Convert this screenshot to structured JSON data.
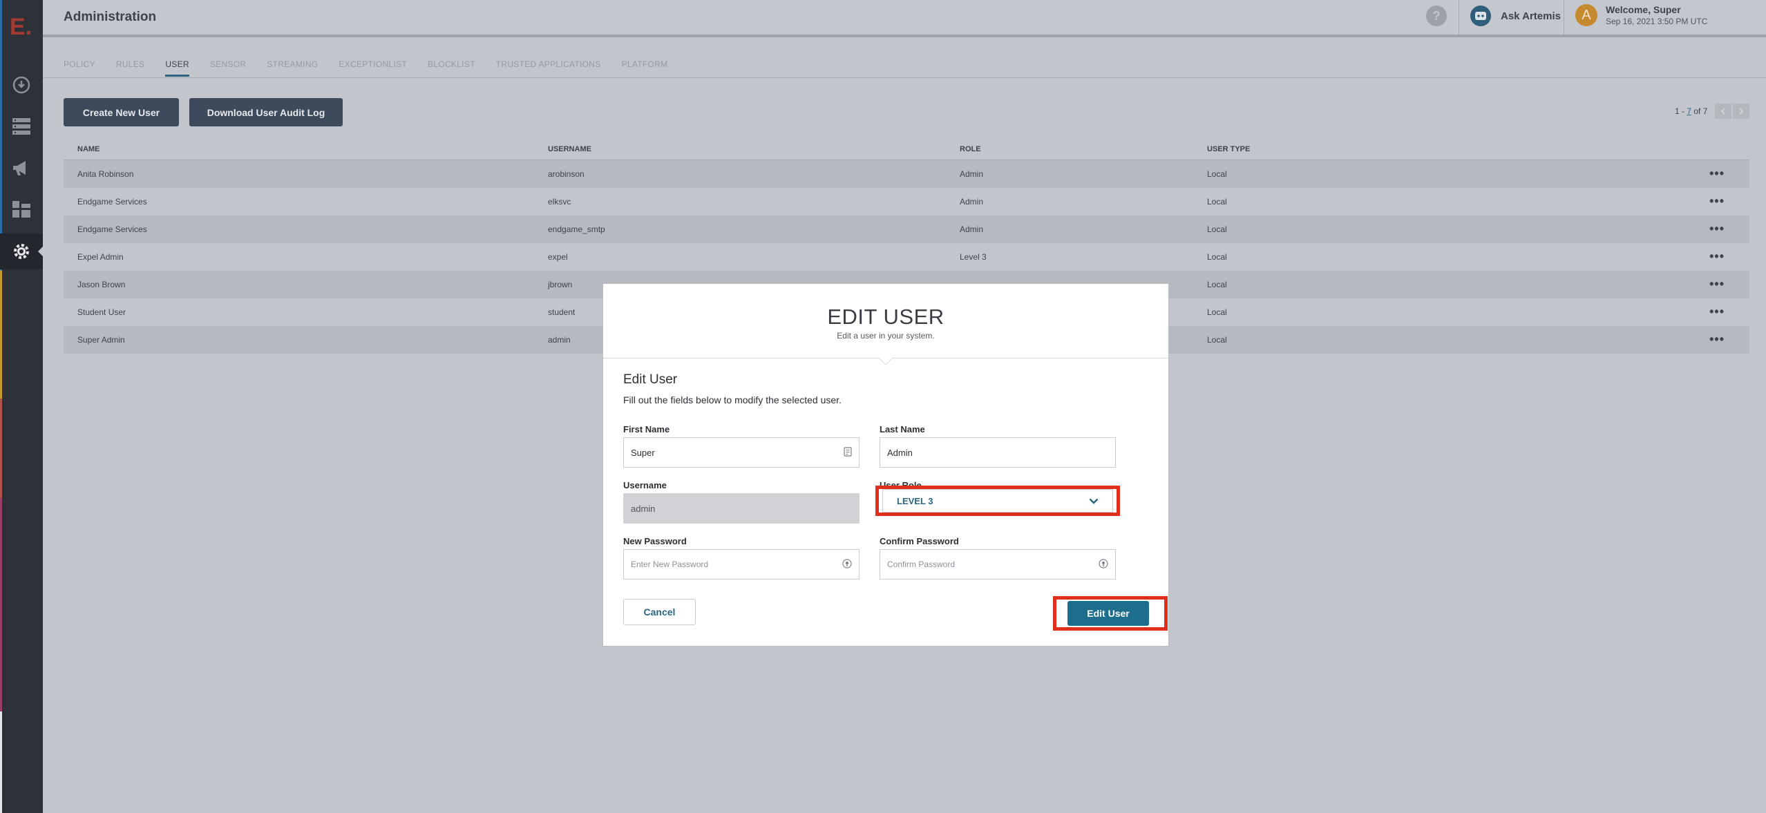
{
  "app": {
    "logo": "E."
  },
  "header": {
    "title": "Administration",
    "help_glyph": "?",
    "ask_label": "Ask Artemis",
    "avatar_letter": "A",
    "welcome": "Welcome, Super",
    "timestamp": "Sep 16, 2021 3:50 PM UTC"
  },
  "tabs": [
    {
      "label": "POLICY",
      "active": false
    },
    {
      "label": "RULES",
      "active": false
    },
    {
      "label": "USER",
      "active": true
    },
    {
      "label": "SENSOR",
      "active": false
    },
    {
      "label": "STREAMING",
      "active": false
    },
    {
      "label": "EXCEPTIONLIST",
      "active": false
    },
    {
      "label": "BLOCKLIST",
      "active": false
    },
    {
      "label": "TRUSTED APPLICATIONS",
      "active": false
    },
    {
      "label": "PLATFORM",
      "active": false
    }
  ],
  "toolbar": {
    "create_label": "Create New User",
    "download_label": "Download User Audit Log",
    "pager_prefix": "1 - ",
    "pager_link": "7",
    "pager_suffix": " of 7"
  },
  "table": {
    "columns": [
      "NAME",
      "USERNAME",
      "ROLE",
      "USER TYPE"
    ],
    "rows": [
      {
        "name": "Anita Robinson",
        "username": "arobinson",
        "role": "Admin",
        "type": "Local"
      },
      {
        "name": "Endgame Services",
        "username": "elksvc",
        "role": "Admin",
        "type": "Local"
      },
      {
        "name": "Endgame Services",
        "username": "endgame_smtp",
        "role": "Admin",
        "type": "Local"
      },
      {
        "name": "Expel Admin",
        "username": "expel",
        "role": "Level 3",
        "type": "Local"
      },
      {
        "name": "Jason Brown",
        "username": "jbrown",
        "role": "",
        "type": "Local"
      },
      {
        "name": "Student User",
        "username": "student",
        "role": "",
        "type": "Local"
      },
      {
        "name": "Super Admin",
        "username": "admin",
        "role": "",
        "type": "Local"
      }
    ],
    "row_menu_glyph": "•••"
  },
  "modal": {
    "title": "EDIT USER",
    "subtitle": "Edit a user in your system.",
    "form_title": "Edit User",
    "form_desc": "Fill out the fields below to modify the selected user.",
    "first_name_label": "First Name",
    "first_name_value": "Super",
    "last_name_label": "Last Name",
    "last_name_value": "Admin",
    "username_label": "Username",
    "username_value": "admin",
    "role_label": "User Role",
    "role_value": "LEVEL 3",
    "new_password_label": "New Password",
    "new_password_placeholder": "Enter New Password",
    "confirm_password_label": "Confirm Password",
    "confirm_password_placeholder": "Confirm Password",
    "cancel_label": "Cancel",
    "submit_label": "Edit User"
  },
  "colors": {
    "highlight": "#e12f1e",
    "accent": "#1d6e8c",
    "rail": "#2e3138"
  }
}
